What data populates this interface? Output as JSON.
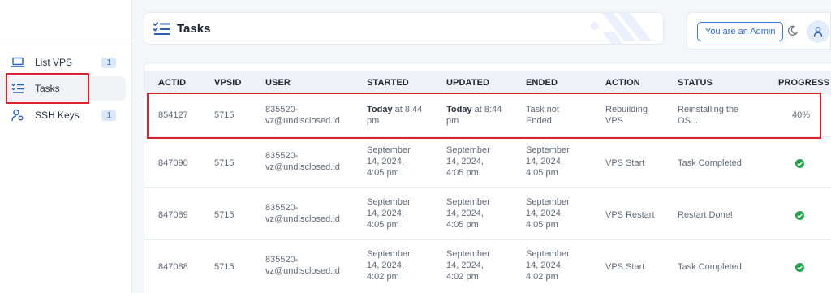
{
  "sidebar": {
    "items": [
      {
        "label": "List VPS",
        "badge": "1"
      },
      {
        "label": "Tasks",
        "badge": ""
      },
      {
        "label": "SSH Keys",
        "badge": "1"
      }
    ]
  },
  "header": {
    "title": "Tasks",
    "admin_label": "You are an Admin"
  },
  "table": {
    "columns": [
      "ACTID",
      "VPSID",
      "USER",
      "STARTED",
      "UPDATED",
      "ENDED",
      "ACTION",
      "STATUS",
      "PROGRESS"
    ],
    "rows": [
      {
        "actid": "854127",
        "vpsid": "5715",
        "user": [
          "835520-",
          "vz@undisclosed.id"
        ],
        "started_bold": "Today",
        "started_rest": " at 8:44",
        "started_line2": "pm",
        "updated_bold": "Today",
        "updated_rest": " at 8:44",
        "updated_line2": "pm",
        "ended": [
          "Task not",
          "Ended"
        ],
        "action": [
          "Rebuilding",
          "VPS"
        ],
        "status": [
          "Reinstalling the",
          "OS..."
        ],
        "progress": "40%"
      },
      {
        "actid": "847090",
        "vpsid": "5715",
        "user": [
          "835520-",
          "vz@undisclosed.id"
        ],
        "started": [
          "September",
          "14, 2024,",
          "4:05 pm"
        ],
        "updated": [
          "September",
          "14, 2024,",
          "4:05 pm"
        ],
        "ended": [
          "September",
          "14, 2024,",
          "4:05 pm"
        ],
        "action": [
          "VPS Start"
        ],
        "status": [
          "Task Completed"
        ],
        "progress_icon": "check-circle-icon"
      },
      {
        "actid": "847089",
        "vpsid": "5715",
        "user": [
          "835520-",
          "vz@undisclosed.id"
        ],
        "started": [
          "September",
          "14, 2024,",
          "4:05 pm"
        ],
        "updated": [
          "September",
          "14, 2024,",
          "4:05 pm"
        ],
        "ended": [
          "September",
          "14, 2024,",
          "4:05 pm"
        ],
        "action": [
          "VPS Restart"
        ],
        "status": [
          "Restart Done!"
        ],
        "progress_icon": "check-circle-icon"
      },
      {
        "actid": "847088",
        "vpsid": "5715",
        "user": [
          "835520-",
          "vz@undisclosed.id"
        ],
        "started": [
          "September",
          "14, 2024,",
          "4:02 pm"
        ],
        "updated": [
          "September",
          "14, 2024,",
          "4:02 pm"
        ],
        "ended": [
          "September",
          "14, 2024,",
          "4:02 pm"
        ],
        "action": [
          "VPS Start"
        ],
        "status": [
          "Task Completed"
        ],
        "progress_icon": "check-circle-icon"
      }
    ]
  },
  "colors": {
    "accent": "#2d6cd4",
    "highlight": "#d9232d",
    "success": "#1fa64a"
  }
}
